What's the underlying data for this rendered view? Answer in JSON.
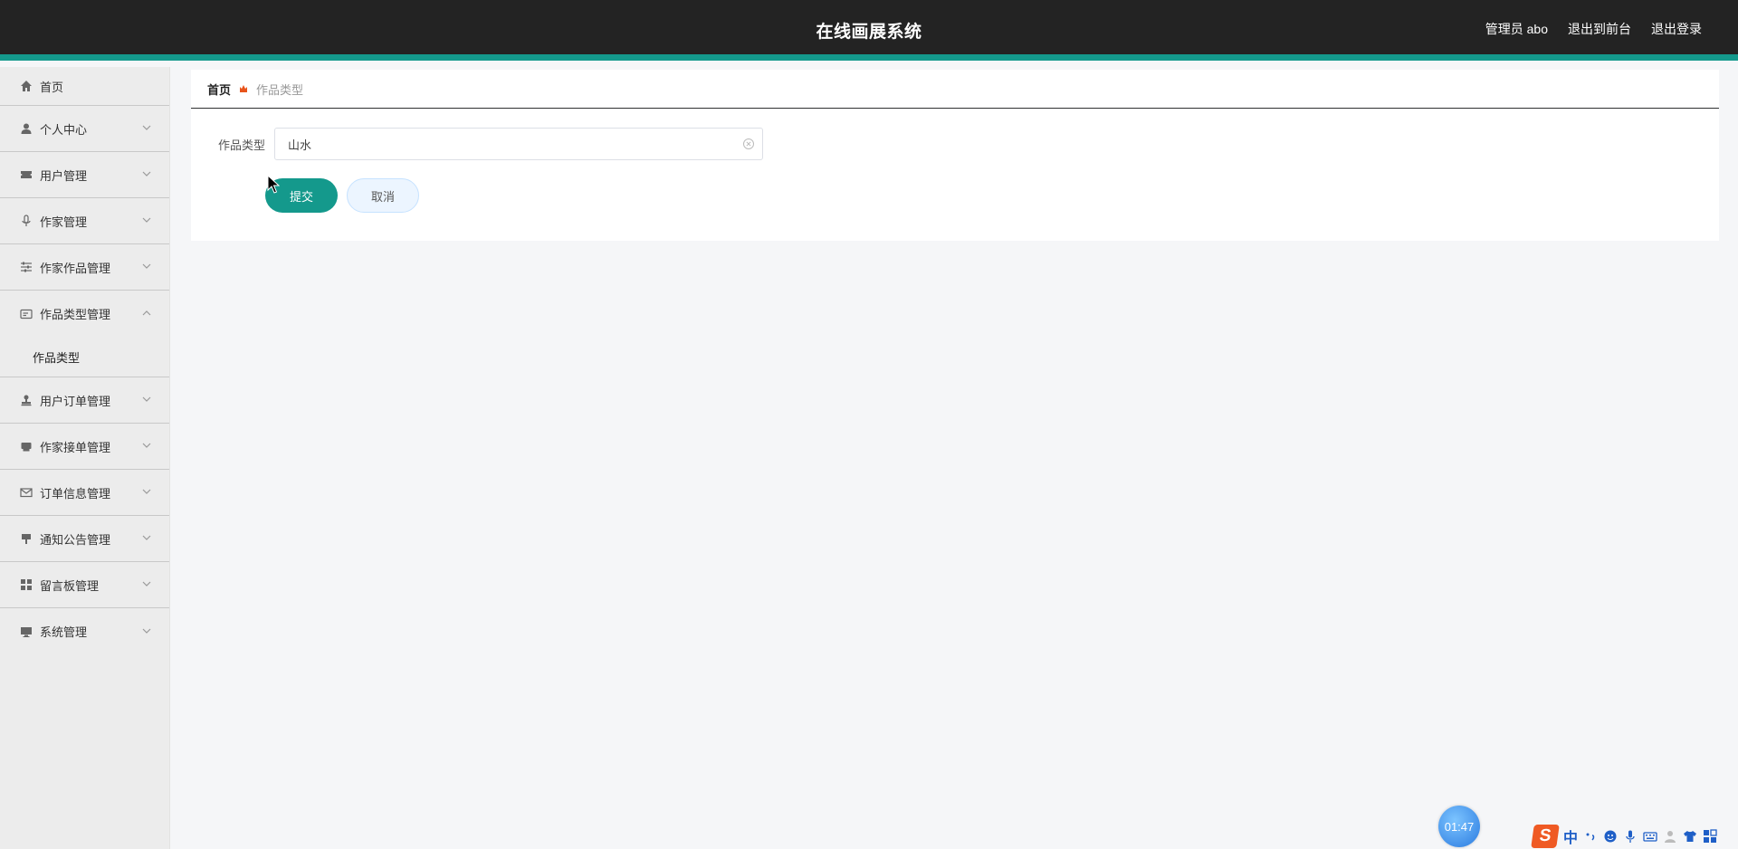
{
  "header": {
    "title": "在线画展系统",
    "links": [
      "管理员 abo",
      "退出到前台",
      "退出登录"
    ]
  },
  "sidebar": {
    "items": [
      {
        "label": "首页",
        "icon": "home-icon"
      },
      {
        "label": "个人中心",
        "icon": "person-icon"
      },
      {
        "label": "用户管理",
        "icon": "ticket-icon"
      },
      {
        "label": "作家管理",
        "icon": "microphone-icon"
      },
      {
        "label": "作家作品管理",
        "icon": "sliders-icon"
      },
      {
        "label": "作品类型管理",
        "icon": "card-icon",
        "expanded": true
      },
      {
        "label": "用户订单管理",
        "icon": "stamp-icon"
      },
      {
        "label": "作家接单管理",
        "icon": "printer-icon"
      },
      {
        "label": "订单信息管理",
        "icon": "mail-icon"
      },
      {
        "label": "通知公告管理",
        "icon": "notice-icon"
      },
      {
        "label": "留言板管理",
        "icon": "grid-icon"
      },
      {
        "label": "系统管理",
        "icon": "monitor-icon"
      }
    ],
    "submenu": {
      "label": "作品类型"
    }
  },
  "breadcrumb": {
    "home": "首页",
    "current": "作品类型"
  },
  "form": {
    "field_label": "作品类型",
    "field_value": "山水",
    "submit_label": "提交",
    "cancel_label": "取消"
  },
  "timer": {
    "value": "01:47"
  },
  "ime": {
    "logo": "S",
    "lang": "中"
  },
  "colors": {
    "accent": "#14998c",
    "header_bg": "#232323",
    "sidebar_bg": "#ececec",
    "breadcrumb_icon": "#e8541b"
  }
}
